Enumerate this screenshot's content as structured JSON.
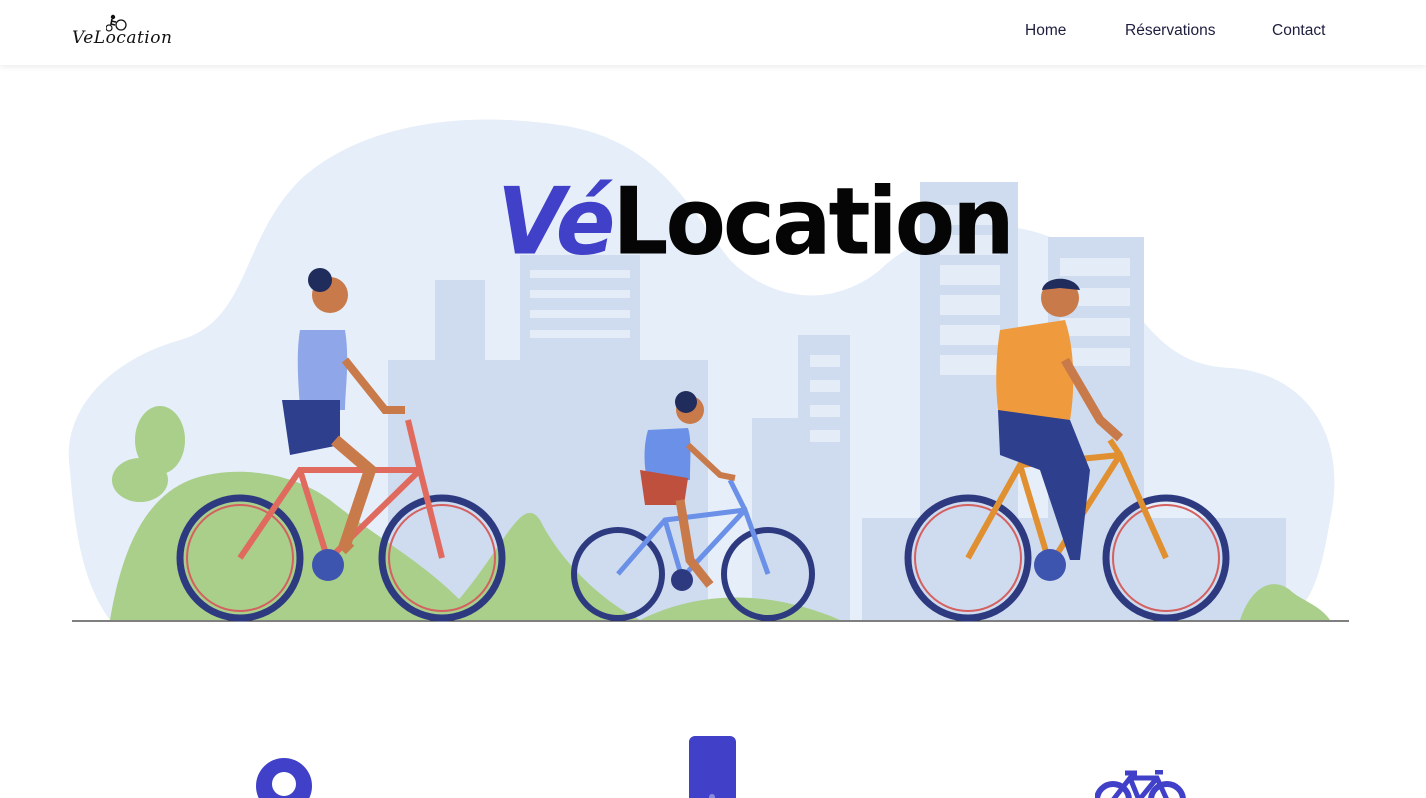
{
  "header": {
    "logo_text": "VeLocation",
    "nav": [
      {
        "label": "Home"
      },
      {
        "label": "Réservations"
      },
      {
        "label": "Contact"
      }
    ]
  },
  "hero": {
    "title_accent": "Vé",
    "title_main": "Location",
    "illustration": "family-cycling-city-illustration"
  },
  "features": {
    "icons": [
      "location-pin-icon",
      "smartphone-icon",
      "bicycle-icon"
    ]
  },
  "colors": {
    "brand_blue": "#4040c8",
    "nav_text": "#1d1d3d",
    "blob": "#e6eef9",
    "building": "#cfdcef",
    "bush": "#a9cf8a"
  }
}
